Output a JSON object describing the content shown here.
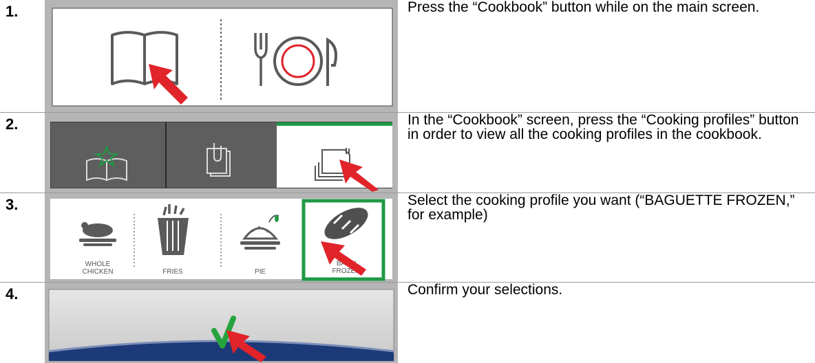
{
  "steps": [
    {
      "number": "1.",
      "text": "Press the “Cookbook” button while on the main screen."
    },
    {
      "number": "2.",
      "text": "In the “Cookbook” screen, press the “Cooking profiles” button in order to view all the cooking profiles in the cookbook."
    },
    {
      "number": "3.",
      "text": "Select the cooking profile you want (“BAGUETTE FROZEN,” for example)"
    },
    {
      "number": "4.",
      "text": "Confirm your selections."
    }
  ],
  "step3_screen": {
    "profiles": [
      {
        "line1": "WHOLE",
        "line2": "CHICKEN",
        "icon": "chicken-icon"
      },
      {
        "line1": "",
        "line2": "FRIES",
        "icon": "fries-icon"
      },
      {
        "line1": "",
        "line2": "PIE",
        "icon": "pie-icon"
      },
      {
        "line1": "BAGU",
        "line2": "FROZEN",
        "icon": "baguette-icon"
      }
    ]
  },
  "colors": {
    "pointer_arrow": "#e0242a",
    "selection_green": "#1f9a45",
    "checkmark_green": "#25a33d",
    "dark_tab": "#5e5e5e",
    "bottom_bar_blue": "#1d3a78",
    "frame_grey": "#b5b5b5"
  }
}
